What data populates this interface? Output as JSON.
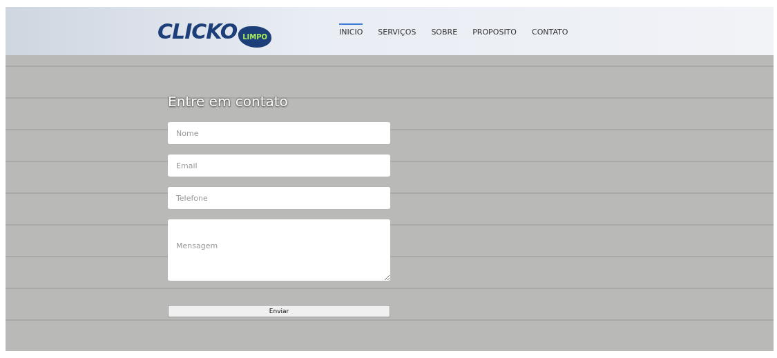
{
  "logo": {
    "word": "CLICKO",
    "badge": "LIMPO"
  },
  "nav": [
    {
      "label": "INICIO",
      "selected": true
    },
    {
      "label": "SERVIÇOS",
      "selected": false
    },
    {
      "label": "SOBRE",
      "selected": false
    },
    {
      "label": "PROPOSITO",
      "selected": false
    },
    {
      "label": "CONTATO",
      "selected": false
    }
  ],
  "form": {
    "title": "Entre em contato",
    "fields": [
      {
        "kind": "input",
        "placeholder": "Nome"
      },
      {
        "kind": "input",
        "placeholder": "Email"
      },
      {
        "kind": "input",
        "placeholder": "Telefone"
      },
      {
        "kind": "textarea",
        "placeholder": "Mensagem"
      }
    ],
    "submit": "Enviar"
  }
}
